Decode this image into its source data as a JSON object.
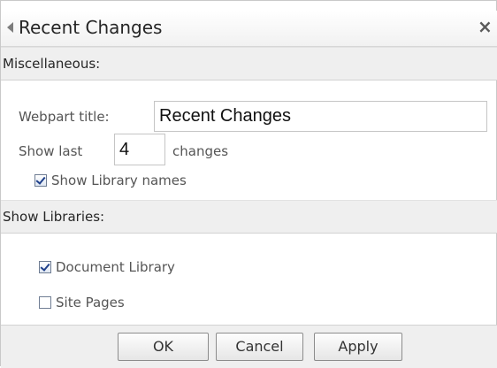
{
  "panel": {
    "title": "Recent Changes",
    "collapse_icon": "collapse-arrow-icon",
    "close_label": "×"
  },
  "misc": {
    "header": "Miscellaneous:",
    "webpart_title_label": "Webpart title:",
    "webpart_title_value": "Recent Changes",
    "show_last_label": "Show last",
    "show_last_value": "4",
    "changes_label": "changes",
    "show_library_names_label": "Show Library names",
    "show_library_names_checked": true
  },
  "libraries": {
    "header": "Show Libraries:",
    "items": [
      {
        "label": "Document Library",
        "checked": true
      },
      {
        "label": "Site Pages",
        "checked": false
      }
    ]
  },
  "buttons": {
    "ok": "OK",
    "cancel": "Cancel",
    "apply": "Apply"
  }
}
